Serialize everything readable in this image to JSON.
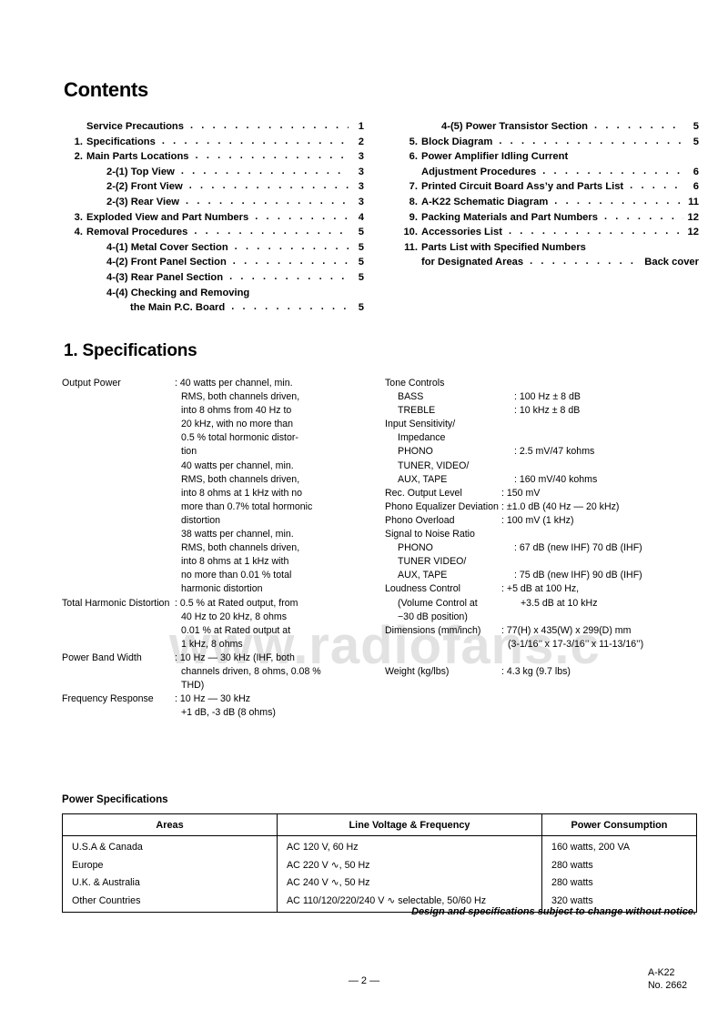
{
  "document": {
    "contents_heading": "Contents",
    "spec_heading": "1. Specifications",
    "power_heading": "Power Specifications",
    "notice": "Design and specifications subject to change without notice.",
    "page_number": "— 2 —",
    "model": "A-K22",
    "doc_number": "No. 2662",
    "watermark": "www.radiofans.c",
    "dot_leader": ". . . . . . . . . . . . . . . . . . . . . . . . . . . . . . . . . . . . . . . . . . . . . . . . . . . ."
  },
  "contents": {
    "left": [
      {
        "num": "",
        "label": "Service Precautions",
        "indent": 0,
        "page": "1",
        "dots": true
      },
      {
        "num": "1.",
        "label": "Specifications",
        "indent": 0,
        "page": "2",
        "dots": true
      },
      {
        "num": "2.",
        "label": "Main Parts Locations",
        "indent": 0,
        "page": "3",
        "dots": true
      },
      {
        "num": "",
        "label": "2-(1) Top View",
        "indent": 1,
        "page": "3",
        "dots": true
      },
      {
        "num": "",
        "label": "2-(2) Front View",
        "indent": 1,
        "page": "3",
        "dots": true
      },
      {
        "num": "",
        "label": "2-(3) Rear View",
        "indent": 1,
        "page": "3",
        "dots": true
      },
      {
        "num": "3.",
        "label": "Exploded View and Part Numbers",
        "indent": 0,
        "page": "4",
        "dots": true
      },
      {
        "num": "4.",
        "label": "Removal Procedures",
        "indent": 0,
        "page": "5",
        "dots": true
      },
      {
        "num": "",
        "label": "4-(1) Metal Cover Section",
        "indent": 1,
        "page": "5",
        "dots": true
      },
      {
        "num": "",
        "label": "4-(2) Front Panel Section",
        "indent": 1,
        "page": "5",
        "dots": true
      },
      {
        "num": "",
        "label": "4-(3) Rear Panel Section",
        "indent": 1,
        "page": "5",
        "dots": true
      },
      {
        "num": "",
        "label": "4-(4) Checking and Removing",
        "indent": 1,
        "page": "",
        "dots": false
      },
      {
        "num": "",
        "label": "the Main P.C. Board",
        "indent": 2,
        "page": "5",
        "dots": true
      }
    ],
    "right": [
      {
        "num": "",
        "label": "4-(5)  Power Transistor Section",
        "indent": 1,
        "page": "5",
        "dots": true
      },
      {
        "num": "5.",
        "label": "Block Diagram",
        "indent": 0,
        "page": "5",
        "dots": true
      },
      {
        "num": "6.",
        "label": "Power Amplifier Idling Current",
        "indent": 0,
        "page": "",
        "dots": false
      },
      {
        "num": "",
        "label": "Adjustment Procedures",
        "indent": 0,
        "page": "6",
        "dots": true
      },
      {
        "num": "7.",
        "label": "Printed Circuit Board Ass’y and Parts List",
        "indent": 0,
        "page": "6",
        "dots": true
      },
      {
        "num": "8.",
        "label": "A-K22 Schematic Diagram",
        "indent": 0,
        "page": "11",
        "dots": true
      },
      {
        "num": "9.",
        "label": "Packing Materials and Part Numbers",
        "indent": 0,
        "page": "12",
        "dots": true
      },
      {
        "num": "10.",
        "label": "Accessories List",
        "indent": 0,
        "page": "12",
        "dots": true
      },
      {
        "num": "11.",
        "label": "Parts List with Specified Numbers",
        "indent": 0,
        "page": "",
        "dots": false
      },
      {
        "num": "",
        "label": "for Designated Areas",
        "indent": 0,
        "page": "Back cover",
        "dots": true
      }
    ]
  },
  "specifications": {
    "left": [
      {
        "term": "Output Power",
        "lines": [
          ": 40 watts per channel, min.",
          "RMS, both channels driven,",
          "into 8 ohms from 40 Hz to",
          "20 kHz, with no more than",
          "0.5 % total hormonic distor-",
          "tion",
          "40 watts per channel, min.",
          "RMS, both channels driven,",
          "into 8 ohms at 1 kHz with no",
          "more than 0.7% total hormonic",
          "distortion",
          "38 watts per channel, min.",
          "RMS, both channels driven,",
          "into 8 ohms at 1 kHz with",
          "no more than 0.01 % total",
          "harmonic distortion"
        ]
      },
      {
        "term": "Total Harmonic Distortion",
        "lines": [
          ": 0.5 % at Rated output, from",
          "40 Hz to 20 kHz, 8 ohms",
          "0.01 % at Rated output at",
          "1 kHz, 8 ohms"
        ]
      },
      {
        "term": "Power Band Width",
        "lines": [
          ": 10 Hz — 30 kHz (IHF, both",
          "channels driven, 8 ohms, 0.08 %",
          "THD)"
        ]
      },
      {
        "term": "Frequency Response",
        "lines": [
          ": 10 Hz — 30 kHz",
          "+1 dB, -3 dB (8 ohms)"
        ]
      }
    ],
    "right": [
      {
        "term": "Tone Controls",
        "indent": 0,
        "lines": []
      },
      {
        "term": "BASS",
        "indent": 1,
        "lines": [
          ": 100 Hz ± 8 dB"
        ]
      },
      {
        "term": "TREBLE",
        "indent": 1,
        "lines": [
          ": 10 kHz ± 8 dB"
        ]
      },
      {
        "term": "Input Sensitivity/",
        "indent": 0,
        "lines": []
      },
      {
        "term": "Impedance",
        "indent": 1,
        "lines": []
      },
      {
        "term": "PHONO",
        "indent": 1,
        "lines": [
          ": 2.5 mV/47 kohms"
        ]
      },
      {
        "term": "TUNER, VIDEO/",
        "indent": 1,
        "lines": []
      },
      {
        "term": "AUX, TAPE",
        "indent": 1,
        "lines": [
          ": 160 mV/40 kohms"
        ]
      },
      {
        "term": "Rec. Output Level",
        "indent": 0,
        "lines": [
          ": 150 mV"
        ]
      },
      {
        "term": "Phono Equalizer Deviation",
        "indent": 0,
        "lines": [
          ": ±1.0 dB (40 Hz — 20 kHz)"
        ]
      },
      {
        "term": "Phono Overload",
        "indent": 0,
        "lines": [
          ": 100 mV (1 kHz)"
        ]
      },
      {
        "term": "Signal to Noise Ratio",
        "indent": 0,
        "lines": []
      },
      {
        "term": "PHONO",
        "indent": 1,
        "lines": [
          ": 67 dB (new IHF)  70 dB (IHF)"
        ]
      },
      {
        "term": "TUNER VIDEO/",
        "indent": 1,
        "lines": []
      },
      {
        "term": "AUX, TAPE",
        "indent": 1,
        "lines": [
          ": 75 dB (new IHF)  90 dB (IHF)"
        ]
      },
      {
        "term": "Loudness Control",
        "indent": 0,
        "lines": [
          ": +5 dB at 100 Hz,"
        ]
      },
      {
        "term": "(Volume Control at",
        "indent": 1,
        "lines": [
          "+3.5 dB at 10 kHz"
        ]
      },
      {
        "term": "−30 dB position)",
        "indent": 1,
        "lines": []
      },
      {
        "term": "Dimensions (mm/inch)",
        "indent": 0,
        "lines": [
          ": 77(H) x 435(W) x 299(D) mm",
          "(3-1/16’’ x 17-3/16’’ x 11-13/16’’)"
        ]
      },
      {
        "term": "",
        "indent": 0,
        "lines": []
      },
      {
        "term": "Weight (kg/lbs)",
        "indent": 0,
        "lines": [
          ": 4.3 kg (9.7 lbs)"
        ]
      }
    ]
  },
  "power_table": {
    "headers": [
      "Areas",
      "Line Voltage & Frequency",
      "Power Consumption"
    ],
    "rows": [
      [
        "U.S.A & Canada",
        "AC 120 V, 60 Hz",
        "160 watts, 200 VA"
      ],
      [
        "Europe",
        "AC 220 V ∿, 50 Hz",
        "280 watts"
      ],
      [
        "U.K. & Australia",
        "AC 240 V ∿, 50 Hz",
        "280 watts"
      ],
      [
        "Other Countries",
        "AC 110/120/220/240 V ∿ selectable, 50/60 Hz",
        "320 watts"
      ]
    ]
  }
}
